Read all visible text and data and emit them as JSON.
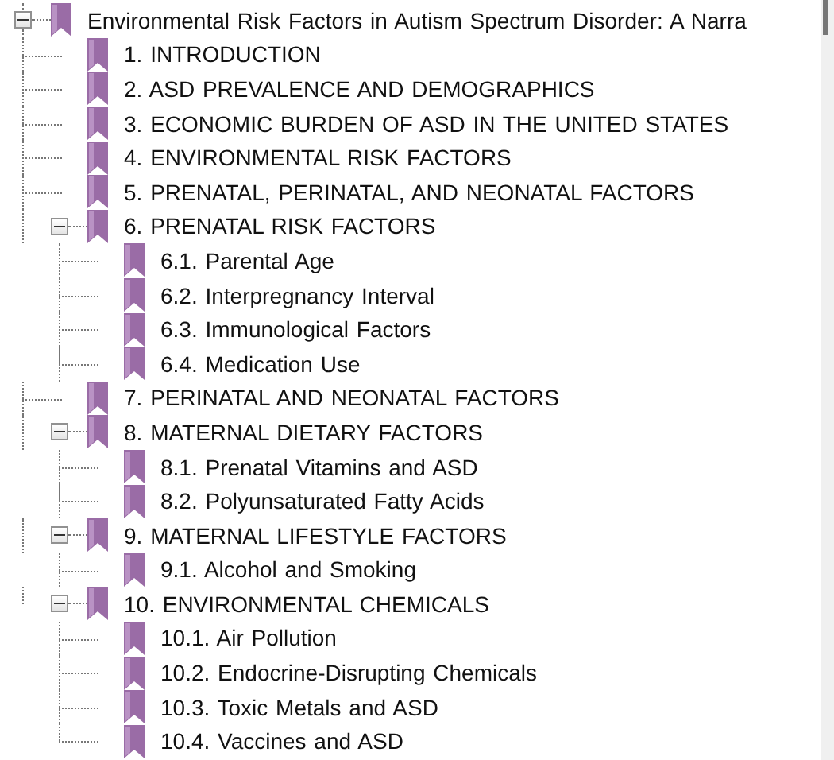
{
  "outline": [
    {
      "title": "Environmental  Risk  Factors  in  Autism  Spectrum  Disorder: A Narra",
      "expanded": true,
      "children": [
        {
          "title": "1. INTRODUCTION"
        },
        {
          "title": "2. ASD PREVALENCE AND DEMOGRAPHICS"
        },
        {
          "title": "3. ECONOMIC BURDEN OF ASD IN THE UNITED STATES"
        },
        {
          "title": "4. ENVIRONMENTAL RISK FACTORS"
        },
        {
          "title": "5. PRENATAL, PERINATAL, AND NEONATAL FACTORS"
        },
        {
          "title": "6. PRENATAL RISK FACTORS",
          "expanded": true,
          "children": [
            {
              "title": "6.1. Parental Age"
            },
            {
              "title": "6.2. Interpregnancy Interval"
            },
            {
              "title": "6.3. Immunological Factors"
            },
            {
              "title": "6.4. Medication Use"
            }
          ]
        },
        {
          "title": "7. PERINATAL AND NEONATAL FACTORS"
        },
        {
          "title": "8. MATERNAL DIETARY FACTORS",
          "expanded": true,
          "children": [
            {
              "title": "8.1. Prenatal Vitamins and ASD"
            },
            {
              "title": "8.2. Polyunsaturated Fatty Acids"
            }
          ]
        },
        {
          "title": "9. MATERNAL LIFESTYLE FACTORS",
          "expanded": true,
          "children": [
            {
              "title": "9.1. Alcohol and Smoking"
            }
          ]
        },
        {
          "title": "10. ENVIRONMENTAL CHEMICALS",
          "expanded": true,
          "children": [
            {
              "title": "10.1. Air Pollution"
            },
            {
              "title": "10.2. Endocrine-Disrupting Chemicals"
            },
            {
              "title": "10.3. Toxic Metals and ASD"
            },
            {
              "title": "10.4. Vaccines and ASD"
            }
          ]
        }
      ]
    }
  ]
}
